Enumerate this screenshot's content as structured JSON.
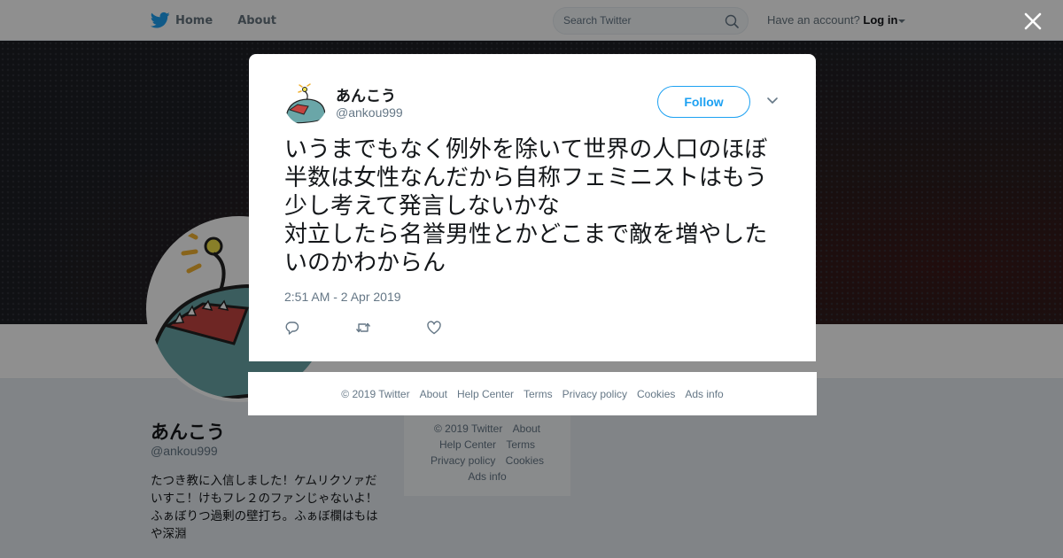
{
  "nav": {
    "home_label": "Home",
    "about_label": "About",
    "search_placeholder": "Search Twitter",
    "account_prompt": "Have an account?",
    "login_label": "Log in"
  },
  "profile": {
    "name": "あんこう",
    "handle": "@ankou999",
    "bio": "たつき教に入信しました！ケムリクソァだいすこ！けもフレ２のファンじゃないよ！ ふぁぼりつ過剰の壁打ち。ふぁぼ欄はもはや深淵"
  },
  "page_footer": {
    "links": [
      "© 2019 Twitter",
      "About",
      "Help Center",
      "Terms",
      "Privacy policy",
      "Cookies",
      "Ads info"
    ]
  },
  "tweet": {
    "author_name": "あんこう",
    "author_handle": "@ankou999",
    "follow_label": "Follow",
    "text": "いうまでもなく例外を除いて世界の人口のほぼ半数は女性なんだから自称フェミニストはもう少し考えて発言しないかな\n対立したら名誉男性とかどこまで敵を増やしたいのかわからん",
    "timestamp": "2:51 AM - 2 Apr 2019"
  },
  "modal_footer": {
    "links": [
      "© 2019 Twitter",
      "About",
      "Help Center",
      "Terms",
      "Privacy policy",
      "Cookies",
      "Ads info"
    ]
  },
  "icons": {
    "logo": "twitter-bird-icon",
    "search": "search-icon",
    "close": "close-icon",
    "chevron": "chevron-down-icon",
    "reply": "reply-icon",
    "retweet": "retweet-icon",
    "like": "heart-icon"
  },
  "colors": {
    "brand": "#1da1f2",
    "text": "#14171a",
    "secondary": "#657786"
  }
}
